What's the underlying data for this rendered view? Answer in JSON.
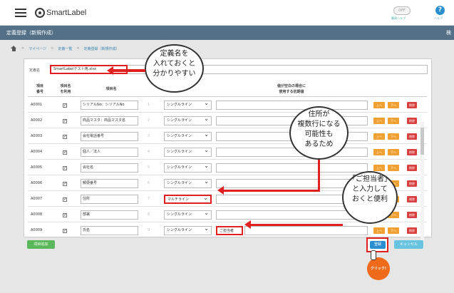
{
  "header": {
    "logo_text": "SmartLabel",
    "toggle_label": "OFF",
    "toggle_caption": "簡易ヘルプ",
    "help_icon": "?",
    "help_caption": "ヘルプ"
  },
  "title": {
    "text": "定義登録（新規作成）",
    "right": "検"
  },
  "breadcrumb": {
    "sep": ">",
    "items": [
      "マイページ",
      "定義一覧",
      "定義登録（新規作成）"
    ]
  },
  "form": {
    "name_label": "定義名",
    "name_value": "SmartLabelテスト用.xlsx"
  },
  "columns": {
    "no": "項目\n番号",
    "use": "項目名\nを利用",
    "name": "項目名",
    "blank": "値が空白の場合に\n使用する初期値"
  },
  "rows": [
    {
      "no": "A0001",
      "name": "シリアルNo：シリアルNo",
      "num": "1",
      "type": "シングルライン",
      "blank": ""
    },
    {
      "no": "A0002",
      "name": "商品マスタ：商品マスタ名",
      "num": "2",
      "type": "シングルライン",
      "blank": ""
    },
    {
      "no": "A0003",
      "name": "会社電話番号",
      "num": "3",
      "type": "シングルライン",
      "blank": ""
    },
    {
      "no": "A0004",
      "name": "個人／法人",
      "num": "4",
      "type": "シングルライン",
      "blank": ""
    },
    {
      "no": "A0005",
      "name": "会社名",
      "num": "5",
      "type": "シングルライン",
      "blank": ""
    },
    {
      "no": "A0006",
      "name": "郵便番号",
      "num": "6",
      "type": "シングルライン",
      "blank": ""
    },
    {
      "no": "A0007",
      "name": "住所",
      "num": "7",
      "type": "マルチライン",
      "blank": ""
    },
    {
      "no": "A0008",
      "name": "部署",
      "num": "8",
      "type": "シングルライン",
      "blank": ""
    },
    {
      "no": "A0009",
      "name": "氏名",
      "num": "9",
      "type": "シングルライン",
      "blank": "ご担当者"
    }
  ],
  "row_buttons": {
    "up": "上へ",
    "down": "下へ",
    "delete": "削除"
  },
  "buttons": {
    "add": "項目追加",
    "register": "登録",
    "cancel": "キャンセル"
  },
  "click_badge": "クリック!",
  "callouts": {
    "c1": [
      "定義名を",
      "入れておくと",
      "分かりやすい"
    ],
    "c2": [
      "住所が",
      "複数行になる",
      "可能性も",
      "あるため"
    ],
    "c3": [
      "「ご担当者」",
      "と入力して",
      "おくと便利"
    ]
  },
  "colors": {
    "accent": "#2b8fcf",
    "highlight": "#e02020",
    "titlebar": "#537087"
  }
}
